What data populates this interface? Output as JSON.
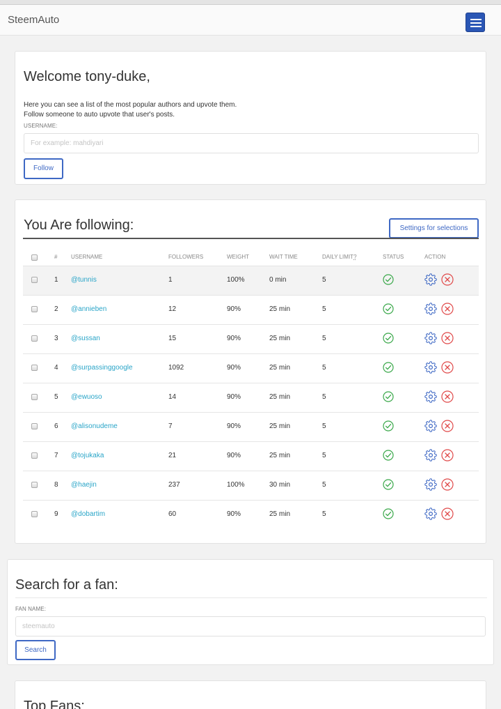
{
  "navbar": {
    "brand": "SteemAuto",
    "menu_icon": "hamburger-menu-icon"
  },
  "welcome": {
    "title": "Welcome tony-duke,",
    "line1": "Here you can see a list of the most popular authors and upvote them.",
    "line2": "Follow someone to auto upvote that user's posts.",
    "username_label": "USERNAME:",
    "username_placeholder": "For example: mahdiyari",
    "username_value": "",
    "follow_label": "Follow"
  },
  "following": {
    "title": "You Are following:",
    "settings_label": "Settings for selections",
    "headers": {
      "num": "#",
      "username": "USERNAME",
      "followers": "FOLLOWERS",
      "weight": "WEIGHT",
      "wait_time": "WAIT TIME",
      "daily_limit": "DAILY LIMIT",
      "daily_limit_help": "?",
      "status": "STATUS",
      "action": "ACTION"
    },
    "rows": [
      {
        "num": "1",
        "username": "@tunnis",
        "followers": "1",
        "weight": "100%",
        "wait_time": "0 min",
        "daily_limit": "5",
        "status": "enabled"
      },
      {
        "num": "2",
        "username": "@annieben",
        "followers": "12",
        "weight": "90%",
        "wait_time": "25 min",
        "daily_limit": "5",
        "status": "enabled"
      },
      {
        "num": "3",
        "username": "@sussan",
        "followers": "15",
        "weight": "90%",
        "wait_time": "25 min",
        "daily_limit": "5",
        "status": "enabled"
      },
      {
        "num": "4",
        "username": "@surpassinggoogle",
        "followers": "1092",
        "weight": "90%",
        "wait_time": "25 min",
        "daily_limit": "5",
        "status": "enabled"
      },
      {
        "num": "5",
        "username": "@ewuoso",
        "followers": "14",
        "weight": "90%",
        "wait_time": "25 min",
        "daily_limit": "5",
        "status": "enabled"
      },
      {
        "num": "6",
        "username": "@alisonudeme",
        "followers": "7",
        "weight": "90%",
        "wait_time": "25 min",
        "daily_limit": "5",
        "status": "enabled"
      },
      {
        "num": "7",
        "username": "@tojukaka",
        "followers": "21",
        "weight": "90%",
        "wait_time": "25 min",
        "daily_limit": "5",
        "status": "enabled"
      },
      {
        "num": "8",
        "username": "@haejin",
        "followers": "237",
        "weight": "100%",
        "wait_time": "30 min",
        "daily_limit": "5",
        "status": "enabled"
      },
      {
        "num": "9",
        "username": "@dobartim",
        "followers": "60",
        "weight": "90%",
        "wait_time": "25 min",
        "daily_limit": "5",
        "status": "enabled"
      }
    ]
  },
  "search": {
    "title": "Search for a fan:",
    "fan_label": "FAN NAME:",
    "fan_placeholder": "steemauto",
    "fan_value": "",
    "search_label": "Search"
  },
  "top_fans": {
    "title": "Top Fans:"
  },
  "colors": {
    "accent": "#3e68c4",
    "link": "#2aa5c8",
    "status_ok": "#3aa84a",
    "remove": "#e04848",
    "settings_icon": "#3e68c4"
  }
}
